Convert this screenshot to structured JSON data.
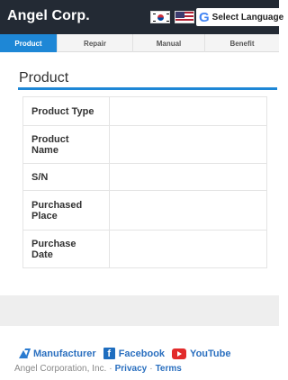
{
  "header": {
    "brand": "Angel Corp.",
    "language_label": "Select Language",
    "language_icon_letter": "G"
  },
  "tabs": [
    {
      "label": "Product",
      "active": true
    },
    {
      "label": "Repair",
      "active": false
    },
    {
      "label": "Manual",
      "active": false
    },
    {
      "label": "Benefit",
      "active": false
    }
  ],
  "panel": {
    "title": "Product",
    "accent_color": "#1e87d6",
    "rows": [
      {
        "label": "Product Type",
        "value": ""
      },
      {
        "label": "Product\nName",
        "value": ""
      },
      {
        "label": "S/N",
        "value": ""
      },
      {
        "label": "Purchased\nPlace",
        "value": ""
      },
      {
        "label": "Purchase\nDate",
        "value": ""
      }
    ]
  },
  "footer": {
    "links": [
      {
        "label": "Manufacturer",
        "icon": "manufacturer-logo-icon"
      },
      {
        "label": "Facebook",
        "icon": "facebook-icon"
      },
      {
        "label": "YouTube",
        "icon": "youtube-icon"
      }
    ],
    "copyright": "Angel Corporation, Inc.",
    "separator": "·",
    "privacy": "Privacy",
    "terms": "Terms"
  }
}
